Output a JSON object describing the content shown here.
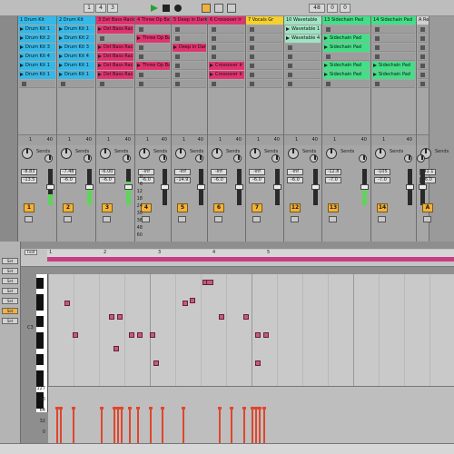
{
  "transport": {
    "position_a": "1",
    "position_b": "4",
    "position_c": "3",
    "bpm_box": "48",
    "misc_box_a": "0",
    "misc_box_b": "0",
    "play_icon": "play-icon",
    "stop_icon": "stop-icon",
    "record_icon": "record-icon"
  },
  "tracks": [
    {
      "name": "1 Drum Kit",
      "color": "#34b8e8",
      "clips": [
        "Drum Kit 1",
        "Drum Kit 2",
        "Drum Kit 3",
        "Drum Kit 4",
        "Drum Kit 1",
        "Drum Kit 1"
      ],
      "vol": "-8.83",
      "pan": "-13.5",
      "ticks_a": "1",
      "ticks_b": "40",
      "num": "1",
      "meter": 0.3
    },
    {
      "name": "2 Drum Kit",
      "color": "#34b8e8",
      "clips": [
        "Drum Kit 1",
        "Drum Kit 2",
        "Drum Kit 3",
        "Drum Kit 4",
        "Drum Kit 1",
        "Drum Kit 1"
      ],
      "vol": "-7.48",
      "pan": "-6.0",
      "ticks_a": "1",
      "ticks_b": "40",
      "num": "2",
      "meter": 0.45
    },
    {
      "name": "3 Dst Bass Rack",
      "color": "#e0336f",
      "clips": [
        "Dst Bass Rack",
        "",
        "Dst Bass Rack",
        "Dst Bass Rack",
        "Dst Bass Rack",
        "Dst Bass Rack"
      ],
      "vol": "-6.00",
      "pan": "-6.0",
      "ticks_a": "1",
      "ticks_b": "40",
      "num": "3",
      "meter": 0.65
    },
    {
      "name": "4 Three Op Ba",
      "color": "#e0336f",
      "clips": [
        "",
        "Three Op Ba",
        "",
        "",
        "Three Op Ba",
        ""
      ],
      "vol": "-inf",
      "pan": "-6.0",
      "ticks_a": "1",
      "ticks_b": "40",
      "num": "4",
      "meter": 0
    },
    {
      "name": "5 Deep in Dark",
      "color": "#e0336f",
      "clips": [
        "",
        "",
        "Deep in Dark",
        "",
        "",
        ""
      ],
      "vol": "-inf",
      "pan": "-14.9",
      "ticks_a": "1",
      "ticks_b": "40",
      "num": "5",
      "meter": 0
    },
    {
      "name": "6 Crossover Ir",
      "color": "#e0336f",
      "clips": [
        "",
        "",
        "",
        "",
        "Crossover Ir",
        "Crossover Ir"
      ],
      "vol": "-inf",
      "pan": "-6.0",
      "ticks_a": "1",
      "ticks_b": "40",
      "num": "6",
      "meter": 0
    },
    {
      "name": "7 Vocals Gr",
      "color": "#f4d030",
      "clips": [
        "",
        "",
        "",
        "",
        "",
        ""
      ],
      "vol": "-inf",
      "pan": "-6.0",
      "ticks_a": "1",
      "ticks_b": "40",
      "num": "7",
      "meter": 0
    },
    {
      "name": "10 Wavetable",
      "color": "#9fe3c3",
      "clips": [
        "Wavetable 1",
        "Wavetable 4",
        "",
        "",
        "",
        ""
      ],
      "vol": "-inf",
      "pan": "-6.0",
      "ticks_a": "1",
      "ticks_b": "40",
      "num": "12",
      "meter": 0
    },
    {
      "name": "13 Sidechain Pad",
      "color": "#42df86",
      "clips": [
        "",
        "Sidechain Pad",
        "Sidechain Pad",
        "",
        "Sidechain Pad",
        "Sidechain Pad"
      ],
      "vol": "-12.8",
      "pan": "-7.0",
      "ticks_a": "1",
      "ticks_b": "40",
      "num": "13",
      "meter": 0.55
    },
    {
      "name": "14 Sidechain Pad",
      "color": "#42df86",
      "clips": [
        "",
        "",
        "",
        "",
        "Sidechain Pad",
        "Sidechain Pad"
      ],
      "vol": "-105",
      "pan": "-7.0",
      "ticks_a": "1",
      "ticks_b": "40",
      "num": "14",
      "meter": 0
    },
    {
      "name": "A Reverb",
      "color": "#d0d0d0",
      "clips": [
        "",
        "",
        "",
        "",
        "",
        ""
      ],
      "vol": "-41.1",
      "pan": "-6.0",
      "ticks_a": "",
      "ticks_b": "",
      "num": "A",
      "meter": 0
    }
  ],
  "meter_scale": [
    "0",
    "6",
    "12",
    "18",
    "24",
    "30",
    "36",
    "48",
    "60"
  ],
  "sends_label": "Sends",
  "clipview": {
    "fold_label": "Fold",
    "ruler_marks": [
      "1",
      "2",
      "3",
      "4",
      "5"
    ],
    "piano_label": "C3",
    "vel_labels": [
      "127",
      "96",
      "64",
      "32",
      "0"
    ],
    "left_buttons": [
      "Set",
      "Set",
      "Set",
      "Set",
      "Set",
      "Set",
      "Set"
    ],
    "notes": [
      {
        "col": 0.04,
        "row": 0.24
      },
      {
        "col": 0.35,
        "row": 0.22
      },
      {
        "col": 0.33,
        "row": 0.24
      },
      {
        "col": 0.15,
        "row": 0.37
      },
      {
        "col": 0.17,
        "row": 0.37
      },
      {
        "col": 0.42,
        "row": 0.37
      },
      {
        "col": 0.48,
        "row": 0.37
      },
      {
        "col": 0.06,
        "row": 0.53
      },
      {
        "col": 0.2,
        "row": 0.53
      },
      {
        "col": 0.22,
        "row": 0.53
      },
      {
        "col": 0.25,
        "row": 0.53
      },
      {
        "col": 0.51,
        "row": 0.53
      },
      {
        "col": 0.53,
        "row": 0.53
      },
      {
        "col": 0.16,
        "row": 0.66
      },
      {
        "col": 0.26,
        "row": 0.79
      },
      {
        "col": 0.51,
        "row": 0.79
      },
      {
        "col": 0.38,
        "row": 0.05
      },
      {
        "col": 0.39,
        "row": 0.05
      }
    ],
    "velocities": [
      {
        "x": 0.02,
        "v": 0.7
      },
      {
        "x": 0.03,
        "v": 0.7
      },
      {
        "x": 0.06,
        "v": 0.7
      },
      {
        "x": 0.13,
        "v": 0.7
      },
      {
        "x": 0.16,
        "v": 0.7
      },
      {
        "x": 0.17,
        "v": 0.7
      },
      {
        "x": 0.18,
        "v": 0.7
      },
      {
        "x": 0.2,
        "v": 0.7
      },
      {
        "x": 0.22,
        "v": 0.7
      },
      {
        "x": 0.25,
        "v": 0.7
      },
      {
        "x": 0.28,
        "v": 0.7
      },
      {
        "x": 0.33,
        "v": 0.7
      },
      {
        "x": 0.42,
        "v": 0.7
      },
      {
        "x": 0.45,
        "v": 0.7
      },
      {
        "x": 0.48,
        "v": 0.7
      },
      {
        "x": 0.5,
        "v": 0.7
      },
      {
        "x": 0.51,
        "v": 0.7
      },
      {
        "x": 0.52,
        "v": 0.7
      },
      {
        "x": 0.53,
        "v": 0.7
      }
    ]
  }
}
